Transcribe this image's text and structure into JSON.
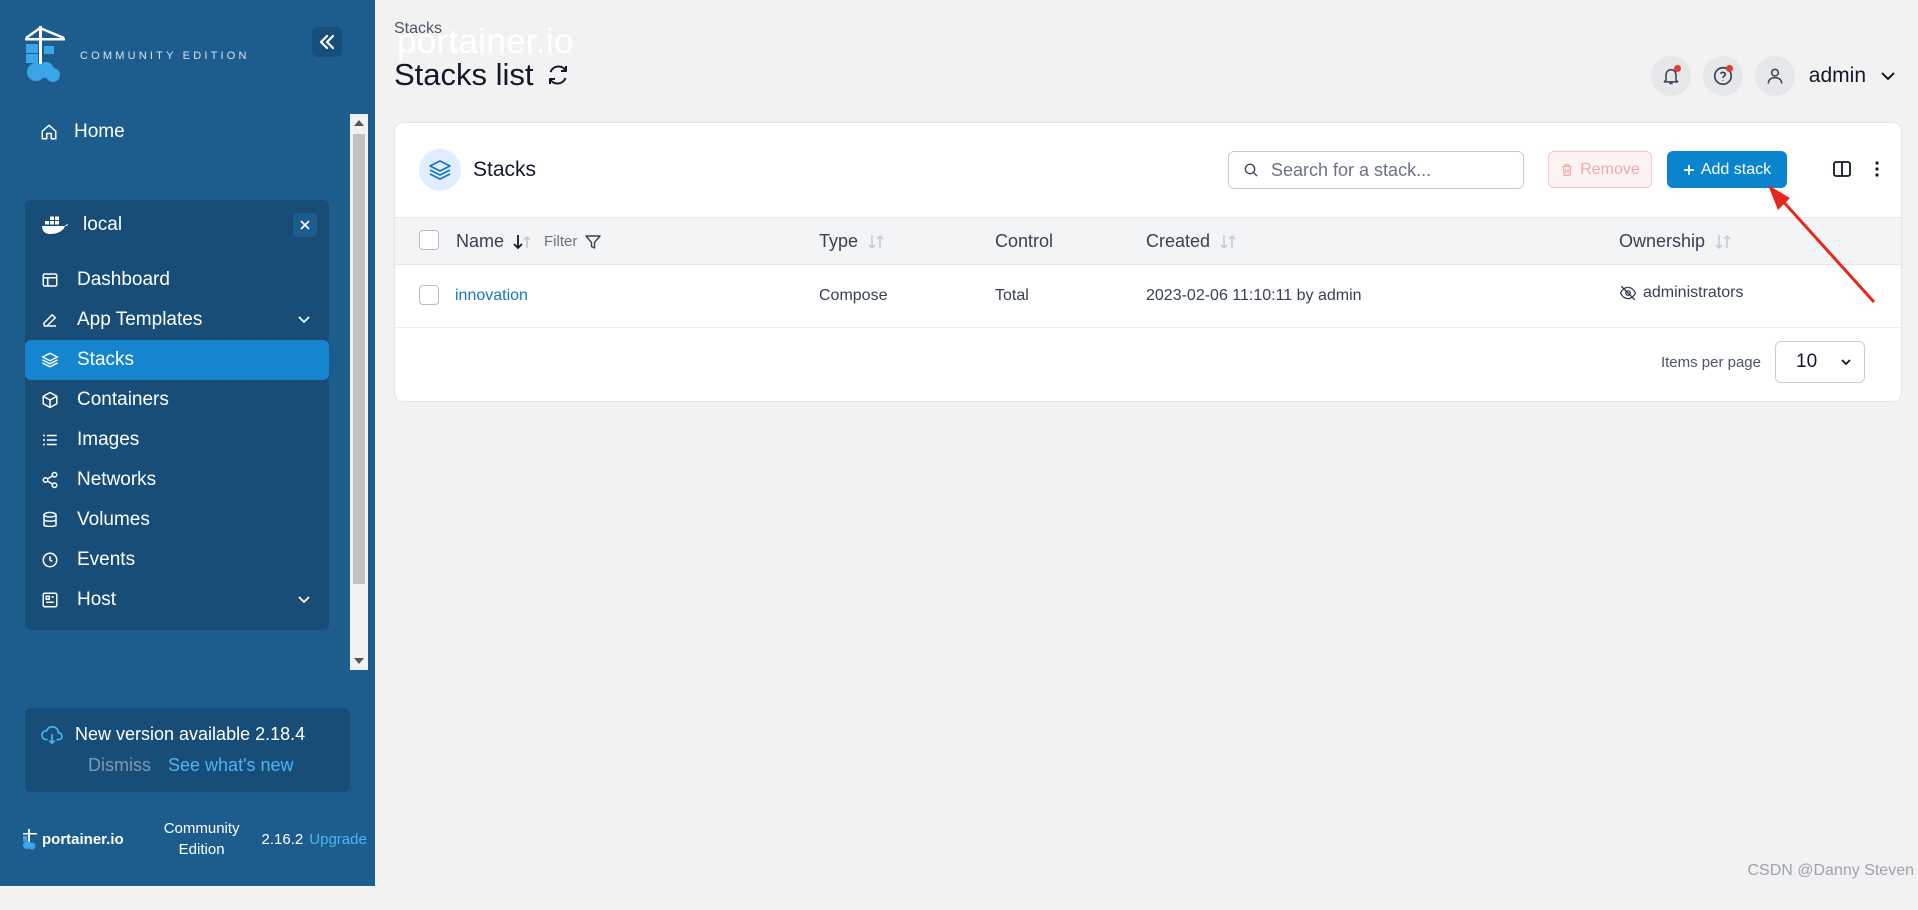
{
  "brand": {
    "name": "portainer.io",
    "edition": "COMMUNITY EDITION"
  },
  "sidebar": {
    "home_label": "Home",
    "environment": {
      "name": "local"
    },
    "items": [
      {
        "label": "Dashboard",
        "icon": "dashboard-icon"
      },
      {
        "label": "App Templates",
        "icon": "edit-icon",
        "expandable": true
      },
      {
        "label": "Stacks",
        "icon": "layers-icon",
        "active": true
      },
      {
        "label": "Containers",
        "icon": "cube-icon"
      },
      {
        "label": "Images",
        "icon": "list-icon"
      },
      {
        "label": "Networks",
        "icon": "share-icon"
      },
      {
        "label": "Volumes",
        "icon": "database-icon"
      },
      {
        "label": "Events",
        "icon": "clock-icon"
      },
      {
        "label": "Host",
        "icon": "server-icon",
        "expandable": true
      }
    ],
    "update": {
      "text": "New version available 2.18.4",
      "dismiss": "Dismiss",
      "see_new": "See what's new"
    },
    "footer": {
      "logo": "portainer.io",
      "edition_line1": "Community",
      "edition_line2": "Edition",
      "version": "2.16.2",
      "upgrade": "Upgrade"
    }
  },
  "header": {
    "breadcrumb": "Stacks",
    "title": "Stacks list",
    "user": "admin"
  },
  "card": {
    "title": "Stacks",
    "search_placeholder": "Search for a stack...",
    "remove_label": "Remove",
    "add_label": "Add stack",
    "columns": {
      "name": "Name",
      "filter": "Filter",
      "type": "Type",
      "control": "Control",
      "created": "Created",
      "ownership": "Ownership"
    },
    "rows": [
      {
        "name": "innovation",
        "type": "Compose",
        "control": "Total",
        "created": "2023-02-06 11:10:11 by admin",
        "ownership": "administrators"
      }
    ],
    "items_per_page_label": "Items per page",
    "items_per_page": "10"
  },
  "watermark": "CSDN @Danny Steven",
  "colors": {
    "sidebar_bg": "#1d5d8e",
    "active_item": "#1585cf",
    "primary_button": "#0b84d0",
    "link": "#1576c4",
    "annotation_arrow": "#e8261c"
  }
}
